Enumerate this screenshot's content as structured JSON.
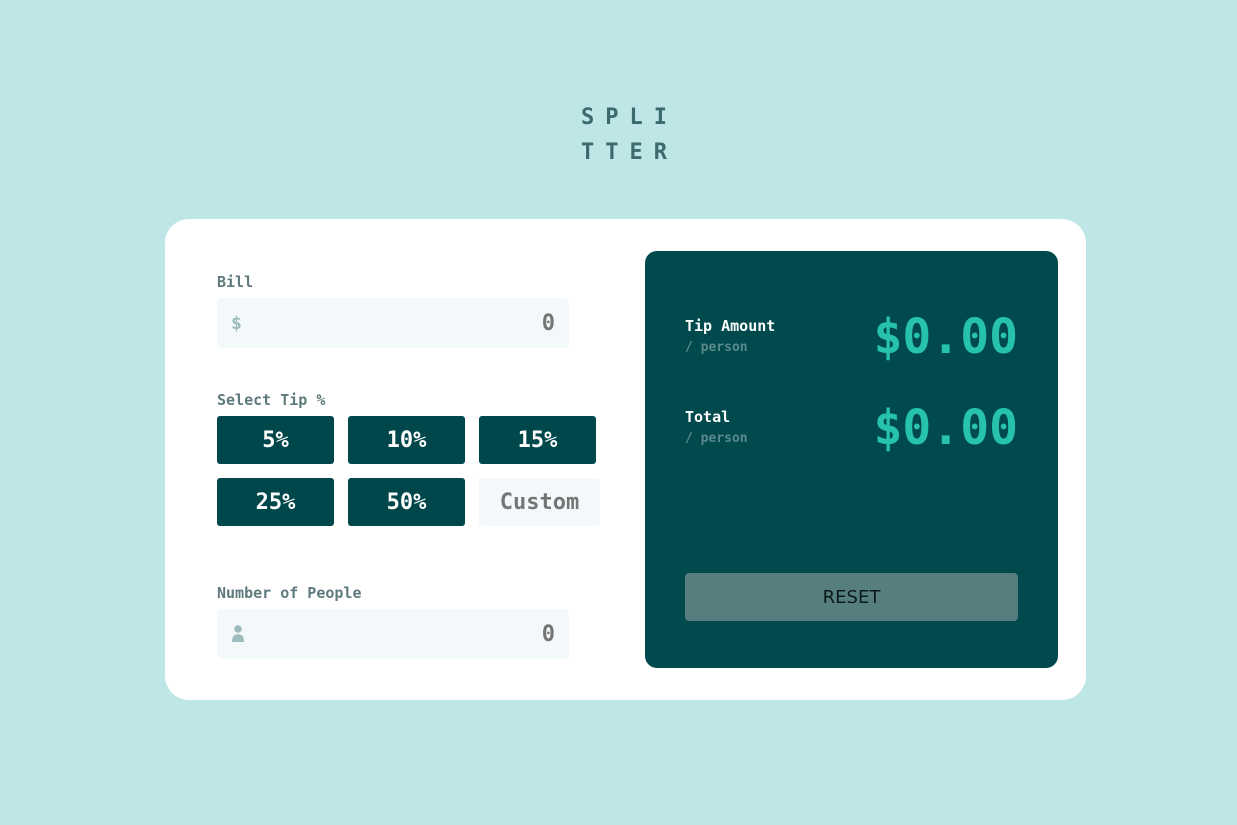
{
  "app": {
    "title_line1": "SPLI",
    "title_line2": "TTER"
  },
  "bill": {
    "label": "Bill",
    "currency_icon": "dollar-icon",
    "currency_symbol": "$",
    "value": "0"
  },
  "tip": {
    "label": "Select Tip %",
    "options": [
      "5%",
      "10%",
      "15%",
      "25%",
      "50%"
    ],
    "custom_placeholder": "Custom"
  },
  "people": {
    "label": "Number of People",
    "icon": "person-icon",
    "value": "0"
  },
  "results": {
    "tip_label": "Tip Amount",
    "tip_sub": "/ person",
    "tip_value": "$0.00",
    "total_label": "Total",
    "total_sub": "/ person",
    "total_value": "$0.00",
    "reset_label": "RESET"
  },
  "colors": {
    "background": "#bee6e7",
    "accent": "#26c2ad",
    "dark": "#00494d",
    "reset_disabled": "#577e7e"
  }
}
